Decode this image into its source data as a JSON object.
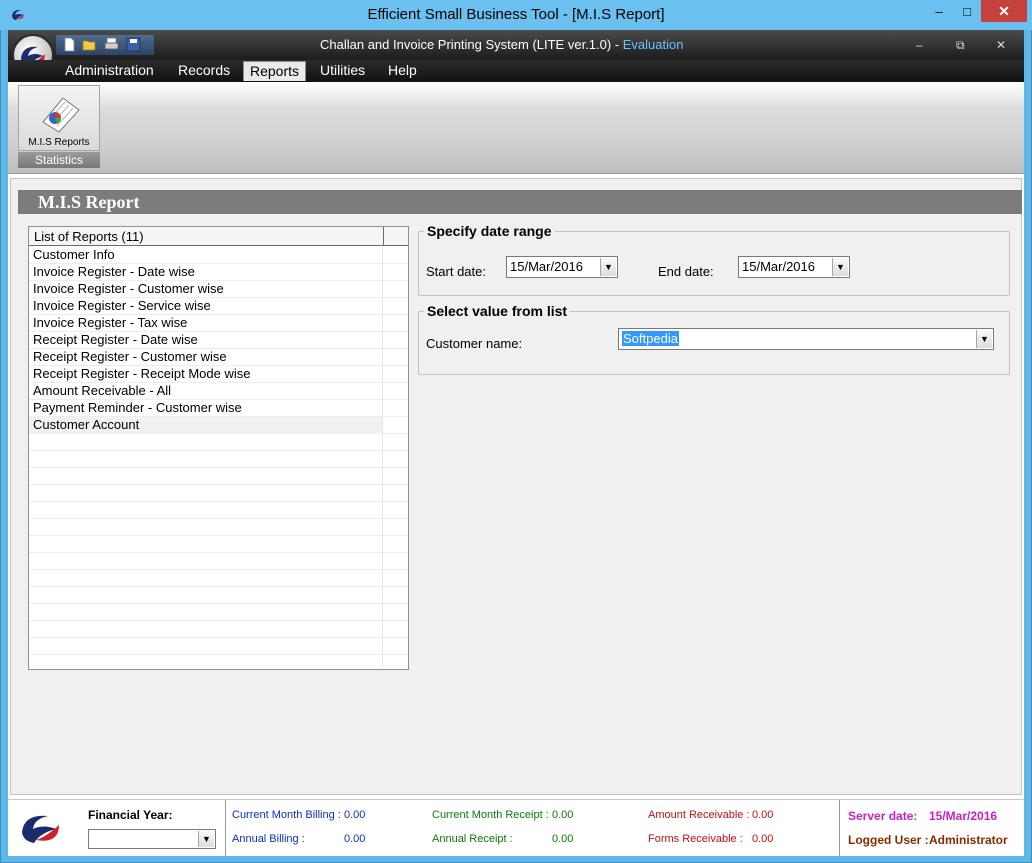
{
  "window": {
    "title": "Efficient Small Business Tool - [M.I.S Report]",
    "min": "–",
    "max": "□",
    "close": "✕"
  },
  "app": {
    "title": "Challan and Invoice Printing System (LITE ver.1.0) - ",
    "edition": "Evaluation",
    "min": "–",
    "restore": "⧉",
    "close": "✕"
  },
  "menu": [
    {
      "label": "Administration"
    },
    {
      "label": "Records"
    },
    {
      "label": "Reports"
    },
    {
      "label": "Utilities"
    },
    {
      "label": "Help"
    }
  ],
  "ribbon": {
    "button_label": "M.I.S Reports",
    "group_label": "Statistics",
    "icon": "report-icon"
  },
  "report": {
    "title": "M.I.S Report",
    "list_header": "List of Reports (11)",
    "items": [
      "Customer Info",
      "Invoice Register - Date wise",
      "Invoice Register - Customer wise",
      "Invoice Register - Service wise",
      "Invoice Register - Tax wise",
      "Receipt Register - Date wise",
      "Receipt Register - Customer wise",
      "Receipt Register - Receipt Mode wise",
      "Amount Receivable - All",
      "Payment Reminder - Customer wise",
      "Customer Account"
    ],
    "selected_item": "Customer Account"
  },
  "date_range": {
    "title": "Specify date range",
    "start_label": "Start date:",
    "start_value": "15/Mar/2016",
    "end_label": "End date:",
    "end_value": "15/Mar/2016"
  },
  "value_list": {
    "title": "Select value from list",
    "customer_label": "Customer name:",
    "customer_value": "Softpedia"
  },
  "status": {
    "financial_year_label": "Financial Year:",
    "financial_year_value": "",
    "current_month_billing_label": "Current Month Billing :",
    "current_month_billing_value": "0.00",
    "annual_billing_label": "Annual Billing :",
    "annual_billing_value": "0.00",
    "current_month_receipt_label": "Current Month Receipt :",
    "current_month_receipt_value": "0.00",
    "annual_receipt_label": "Annual Receipt :",
    "annual_receipt_value": "0.00",
    "amount_receivable_label": "Amount Receivable :",
    "amount_receivable_value": "0.00",
    "forms_receivable_label": "Forms Receivable :",
    "forms_receivable_value": "0.00",
    "server_date_label": "Server date:",
    "server_date_value": "15/Mar/2016",
    "logged_user_label": "Logged User :",
    "logged_user_value": "Administrator"
  },
  "colors": {
    "window_frame": "#6ac0ef",
    "close_button": "#c7413c",
    "header_gray": "#7c7c7c",
    "selection": "#3399ff"
  }
}
